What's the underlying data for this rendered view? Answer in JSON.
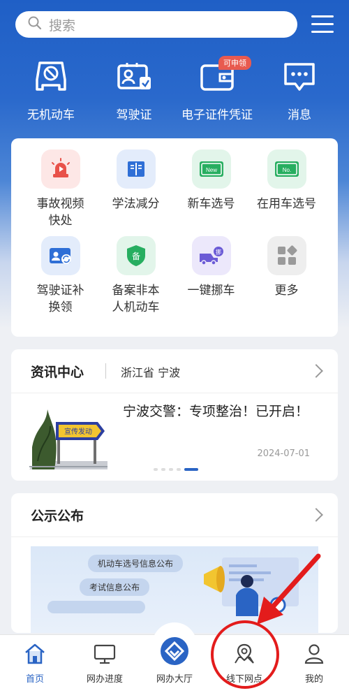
{
  "search": {
    "placeholder": "搜索"
  },
  "quick_actions": [
    {
      "label": "无机动车",
      "icon": "car-outline-icon"
    },
    {
      "label": "驾驶证",
      "icon": "license-icon"
    },
    {
      "label": "电子证件凭证",
      "icon": "wallet-icon"
    },
    {
      "label": "消息",
      "icon": "message-icon"
    }
  ],
  "badge": {
    "text": "可申领"
  },
  "services": [
    {
      "label": "事故视频\n快处",
      "icon": "alarm-light-icon",
      "bg": "#fde7e6",
      "fg": "#e8524a"
    },
    {
      "label": "学法减分",
      "icon": "book-icon",
      "bg": "#e3ecfb",
      "fg": "#2f6fd6"
    },
    {
      "label": "新车选号",
      "icon": "new-plate-icon",
      "bg": "#e2f5ea",
      "fg": "#27ae60"
    },
    {
      "label": "在用车选号",
      "icon": "no-plate-icon",
      "bg": "#e2f5ea",
      "fg": "#27ae60"
    },
    {
      "label": "驾驶证补\n换领",
      "icon": "id-card-icon",
      "bg": "#e3ecfb",
      "fg": "#2f6fd6"
    },
    {
      "label": "备案非本\n人机动车",
      "icon": "shield-icon",
      "bg": "#e2f5ea",
      "fg": "#27ae60"
    },
    {
      "label": "一键挪车",
      "icon": "truck-icon",
      "bg": "#ece8fb",
      "fg": "#6b5bd6"
    },
    {
      "label": "更多",
      "icon": "grid-more-icon",
      "bg": "#eeeeee",
      "fg": "#9a9a9a"
    }
  ],
  "news": {
    "title": "资讯中心",
    "region": "浙江省 宁波",
    "headline": "宁波交警：专项整治！已开启！",
    "date": "2024-07-01",
    "sign_text": "宣传发动"
  },
  "notice": {
    "title": "公示公布",
    "items": [
      "机动车选号信息公布",
      "考试信息公布"
    ]
  },
  "tabs": [
    {
      "label": "首页",
      "icon": "home-icon"
    },
    {
      "label": "网办进度",
      "icon": "monitor-icon"
    },
    {
      "label": "网办大厅",
      "icon": "hall-icon"
    },
    {
      "label": "线下网点",
      "icon": "location-pin-icon"
    },
    {
      "label": "我的",
      "icon": "user-icon"
    }
  ],
  "colors": {
    "accent": "#2a64c4",
    "hero": "#1f5fc6",
    "annotation": "#e31c1c"
  }
}
